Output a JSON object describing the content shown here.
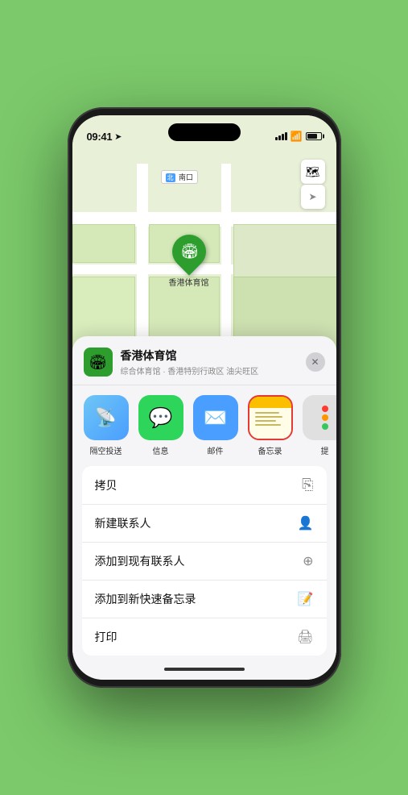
{
  "status_bar": {
    "time": "09:41",
    "location_arrow": "▶"
  },
  "map": {
    "entrance_label": "南口",
    "entrance_prefix": "北",
    "stadium_name": "香港体育馆",
    "controls": {
      "map_icon": "🗺",
      "location_icon": "◎"
    }
  },
  "venue_card": {
    "name": "香港体育馆",
    "subtitle": "综合体育馆 · 香港特别行政区 油尖旺区",
    "close_label": "✕"
  },
  "share_items": [
    {
      "id": "airdrop",
      "label": "隔空投送",
      "icon": "airdrop"
    },
    {
      "id": "messages",
      "label": "信息",
      "icon": "messages"
    },
    {
      "id": "mail",
      "label": "邮件",
      "icon": "mail"
    },
    {
      "id": "notes",
      "label": "备忘录",
      "icon": "notes"
    }
  ],
  "action_items": [
    {
      "id": "copy",
      "label": "拷贝",
      "icon": "📋"
    },
    {
      "id": "new-contact",
      "label": "新建联系人",
      "icon": "👤"
    },
    {
      "id": "add-existing",
      "label": "添加到现有联系人",
      "icon": "👤"
    },
    {
      "id": "add-notes",
      "label": "添加到新快速备忘录",
      "icon": "📝"
    },
    {
      "id": "print",
      "label": "打印",
      "icon": "🖨"
    }
  ],
  "colors": {
    "green_accent": "#2d9e2d",
    "notes_selected_border": "#e53935"
  }
}
